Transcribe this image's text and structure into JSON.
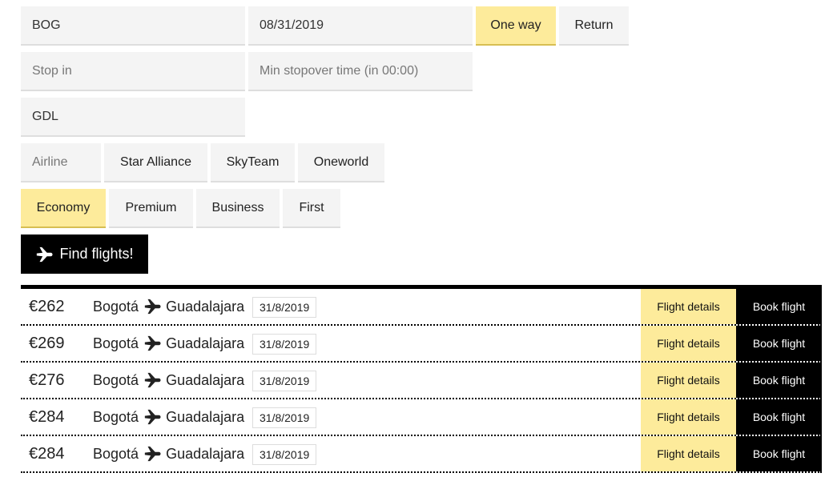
{
  "search": {
    "origin": "BOG",
    "date": "08/31/2019",
    "trip_types": [
      "One way",
      "Return"
    ],
    "stop_in_placeholder": "Stop in",
    "min_stopover_placeholder": "Min stopover time (in 00:00)",
    "destination": "GDL",
    "airline_placeholder": "Airline",
    "alliances": [
      "Star Alliance",
      "SkyTeam",
      "Oneworld"
    ],
    "cabins": [
      "Economy",
      "Premium",
      "Business",
      "First"
    ],
    "find_label": "Find flights!"
  },
  "colors": {
    "accent": "#fdeb9b",
    "field_bg": "#f4f4f4",
    "black": "#000000"
  },
  "results": [
    {
      "price": "€262",
      "from": "Bogotá",
      "to": "Guadalajara",
      "date": "31/8/2019",
      "details_label": "Flight details",
      "book_label": "Book flight"
    },
    {
      "price": "€269",
      "from": "Bogotá",
      "to": "Guadalajara",
      "date": "31/8/2019",
      "details_label": "Flight details",
      "book_label": "Book flight"
    },
    {
      "price": "€276",
      "from": "Bogotá",
      "to": "Guadalajara",
      "date": "31/8/2019",
      "details_label": "Flight details",
      "book_label": "Book flight"
    },
    {
      "price": "€284",
      "from": "Bogotá",
      "to": "Guadalajara",
      "date": "31/8/2019",
      "details_label": "Flight details",
      "book_label": "Book flight"
    },
    {
      "price": "€284",
      "from": "Bogotá",
      "to": "Guadalajara",
      "date": "31/8/2019",
      "details_label": "Flight details",
      "book_label": "Book flight"
    }
  ]
}
